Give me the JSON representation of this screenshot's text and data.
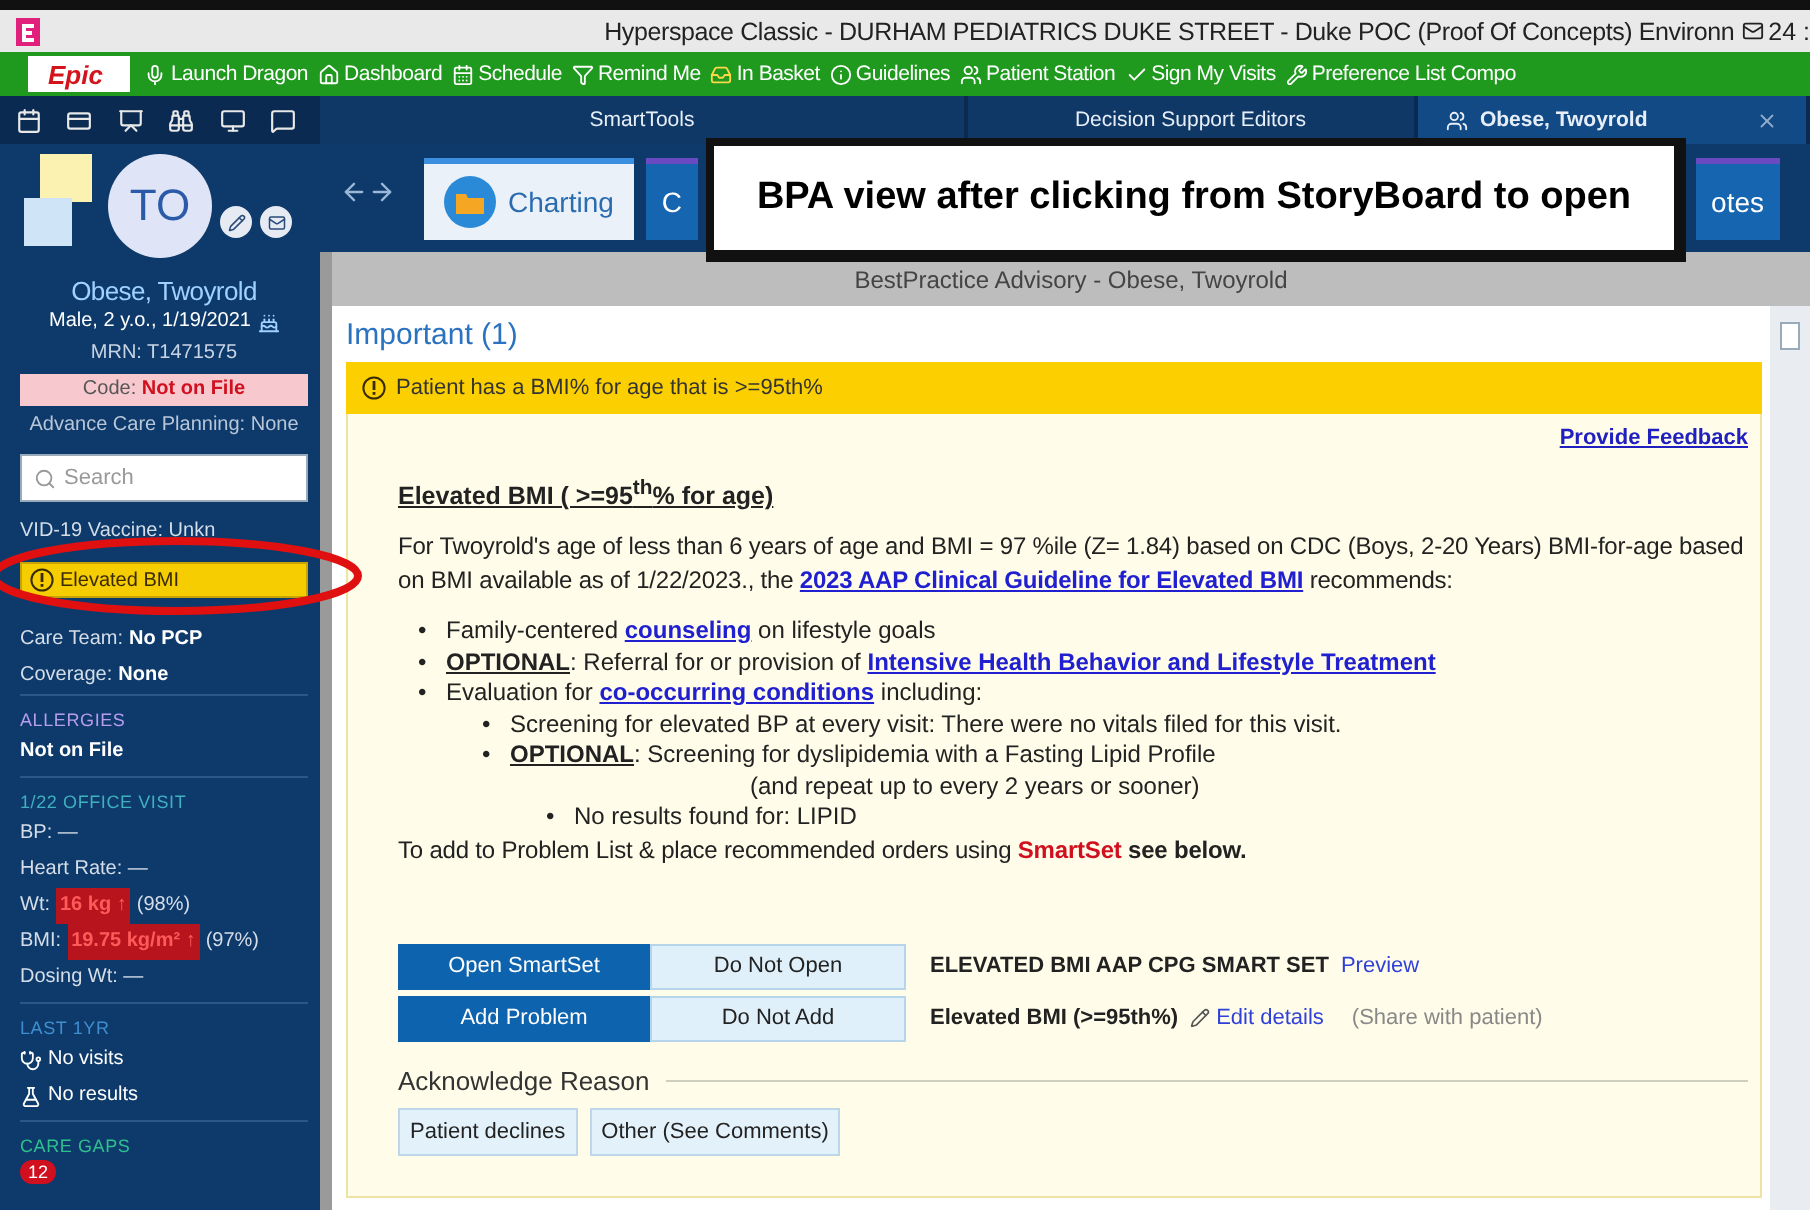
{
  "window": {
    "title": "Hyperspace Classic - DURHAM PEDIATRICS DUKE STREET - Duke POC (Proof Of Concepts) Environn",
    "counter": "24 :"
  },
  "toolbar": {
    "logo": "Epic",
    "items": [
      "Launch Dragon",
      "Dashboard",
      "Schedule",
      "Remind Me",
      "In Basket",
      "Guidelines",
      "Patient Station",
      "Sign My Visits",
      "Preference List Compo"
    ]
  },
  "tabs": [
    {
      "label": "SmartTools",
      "selected": false
    },
    {
      "label": "Decision Support Editors",
      "selected": false
    },
    {
      "label": "Obese, Twoyrold",
      "selected": true,
      "closable": true
    }
  ],
  "sidebar": {
    "initials": "TO",
    "name": "Obese, Twoyrold",
    "demographics": "Male, 2 y.o., 1/19/2021",
    "mrn": "MRN: T1471575",
    "code_label": "Code:",
    "code_value": "Not on File",
    "advance_care": "Advance Care Planning: None",
    "search_placeholder": "Search",
    "vaccine": "VID-19 Vaccine: Unkn",
    "alert": "Elevated BMI",
    "care_team": [
      {
        "label": "Care Team:",
        "value": "No PCP"
      },
      {
        "label": "Coverage:",
        "value": "None"
      }
    ],
    "sections": [
      {
        "title": "ALLERGIES",
        "color": "#b79cf0",
        "lines": [
          {
            "kind": "bold",
            "label": "Not on File"
          }
        ]
      },
      {
        "title": "1/22 OFFICE VISIT",
        "color": "#3fb0c0",
        "lines": [
          {
            "kind": "plain",
            "label": "BP: —"
          },
          {
            "kind": "plain",
            "label": "Heart Rate: —"
          },
          {
            "kind": "flag",
            "label": "Wt:",
            "value": "16 kg",
            "arrow": "↑",
            "extra": "(98%)"
          },
          {
            "kind": "flag",
            "label": "BMI:",
            "value": "19.75 kg/m²",
            "arrow": "↑",
            "extra": "(97%)"
          },
          {
            "kind": "plain",
            "label": "Dosing Wt: —"
          }
        ]
      },
      {
        "title": "LAST 1YR",
        "color": "#3f8fd0",
        "lines": [
          {
            "kind": "visits",
            "label": "No visits"
          },
          {
            "kind": "results",
            "label": "No results"
          }
        ]
      },
      {
        "title": "CARE GAPS",
        "color": "#2fc090",
        "lines": [
          {
            "kind": "badge",
            "label": "12"
          }
        ]
      }
    ]
  },
  "workspace_tabs": [
    {
      "label": "Charting",
      "selected": true
    },
    {
      "label": "C",
      "selected": false
    },
    {
      "label": "otes",
      "selected": false
    }
  ],
  "annotation": {
    "text": "BPA view after clicking from StoryBoard to open"
  },
  "advisory": {
    "title": "BestPractice Advisory - Obese, Twoyrold",
    "section": "Important (1)",
    "banner": "Patient has a BMI% for age that is >=95th%",
    "feedback": "Provide Feedback",
    "heading": "Elevated BMI ( >=95$^{th}$% for age)",
    "intro": [
      {
        "kind": "text",
        "text": "For Twoyrold's age of less than 6 years of age and BMI = 97 %ile (Z= 1.84) based on CDC (Boys, 2-20 Years) BMI-for-age based on BMI available as of 1/22/2023., the "
      },
      {
        "kind": "link",
        "text": "2023 AAP Clinical Guideline for Elevated BMI"
      },
      {
        "kind": "text",
        "text": " recommends:"
      }
    ],
    "bullets": [
      {
        "marker": "•",
        "parts": [
          {
            "kind": "text",
            "text": "Family-centered "
          },
          {
            "kind": "link",
            "text": "counseling"
          },
          {
            "kind": "text",
            "text": " on lifestyle goals"
          }
        ]
      },
      {
        "marker": "•",
        "parts": [
          {
            "kind": "strong",
            "text": "OPTIONAL"
          },
          {
            "kind": "text",
            "text": ": Referral for or provision of "
          },
          {
            "kind": "link",
            "text": "Intensive Health Behavior and Lifestyle Treatment"
          }
        ]
      },
      {
        "marker": "•",
        "parts": [
          {
            "kind": "text",
            "text": "Evaluation for "
          },
          {
            "kind": "link",
            "text": "co-occurring conditions"
          },
          {
            "kind": "text",
            "text": " including:"
          }
        ],
        "children": [
          {
            "marker": "•",
            "parts": [
              {
                "kind": "text",
                "text": "Screening for elevated BP at every visit: There were no vitals filed for this visit."
              }
            ]
          },
          {
            "marker": "•",
            "parts": [
              {
                "kind": "strong",
                "text": "OPTIONAL"
              },
              {
                "kind": "text",
                "text": ": Screening for dyslipidemia with a Fasting Lipid Profile"
              }
            ],
            "note": "(and repeat up to every 2 years or sooner)",
            "children": [
              {
                "marker": "•",
                "parts": [
                  {
                    "kind": "text",
                    "text": "No results found for: LIPID"
                  }
                ]
              }
            ]
          }
        ]
      }
    ],
    "footer": [
      {
        "kind": "text",
        "text": "To add to Problem List & place recommended orders using "
      },
      {
        "kind": "red",
        "text": "SmartSet"
      },
      {
        "kind": "bold",
        "text": " see below."
      }
    ],
    "actions": [
      {
        "primary": "Open SmartSet",
        "secondary": "Do Not Open",
        "item": "ELEVATED BMI AAP CPG SMART SET",
        "link": "Preview"
      },
      {
        "primary": "Add Problem",
        "secondary": "Do Not Add",
        "item": "Elevated BMI (>=95th%)",
        "edit": "Edit details",
        "share": "(Share with patient)"
      }
    ],
    "acknowledge": {
      "title": "Acknowledge Reason",
      "reasons": [
        "Patient declines",
        "Other (See Comments)"
      ]
    }
  }
}
